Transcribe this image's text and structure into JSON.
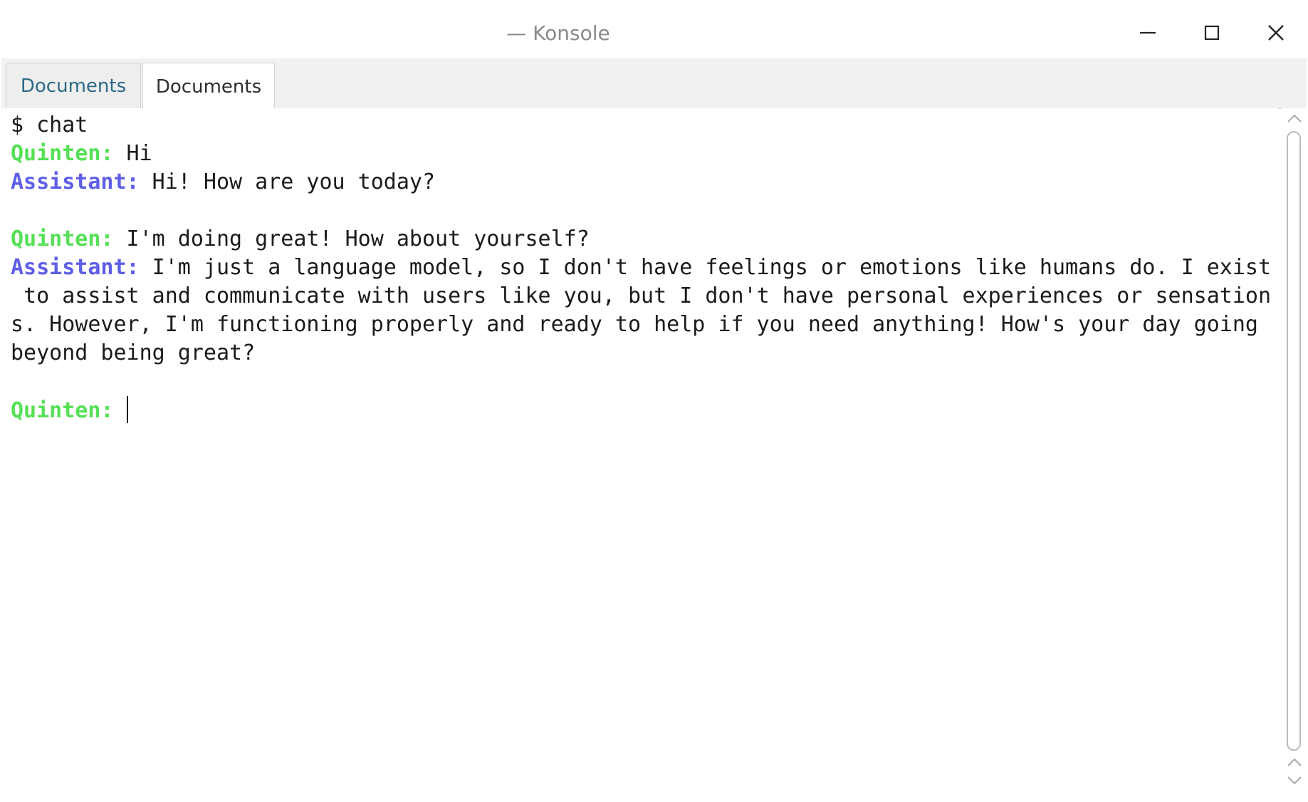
{
  "window": {
    "title": "— Konsole",
    "minimize_icon": "minimize-icon",
    "maximize_icon": "maximize-icon",
    "close_icon": "close-icon"
  },
  "tabs": [
    {
      "label": "Documents",
      "active": false
    },
    {
      "label": "Documents",
      "active": true
    }
  ],
  "terminal": {
    "lines": [
      {
        "speaker": "",
        "text": "$ chat"
      },
      {
        "speaker": "Quinten:",
        "text": " Hi"
      },
      {
        "speaker": "Assistant:",
        "text": " Hi! How are you today?"
      },
      {
        "speaker": "",
        "text": ""
      },
      {
        "speaker": "Quinten:",
        "text": " I'm doing great! How about yourself?"
      },
      {
        "speaker": "Assistant:",
        "text": " I'm just a language model, so I don't have feelings or emotions like humans do. I exist"
      },
      {
        "speaker": "",
        "text": " to assist and communicate with users like you, but I don't have personal experiences or sensation"
      },
      {
        "speaker": "",
        "text": "s. However, I'm functioning properly and ready to help if you need anything! How's your day going"
      },
      {
        "speaker": "",
        "text": "beyond being great?"
      },
      {
        "speaker": "",
        "text": ""
      },
      {
        "speaker": "Quinten:",
        "text": " "
      }
    ]
  },
  "colors": {
    "user_prompt": "#55e055",
    "assistant_prompt": "#5e5ee6",
    "tab_inactive_text": "#2c6a86",
    "title_text": "#8a8a8a"
  },
  "scrollbar": {
    "up_icon": "chevron-up-icon",
    "down_icon": "chevron-down-icon"
  }
}
